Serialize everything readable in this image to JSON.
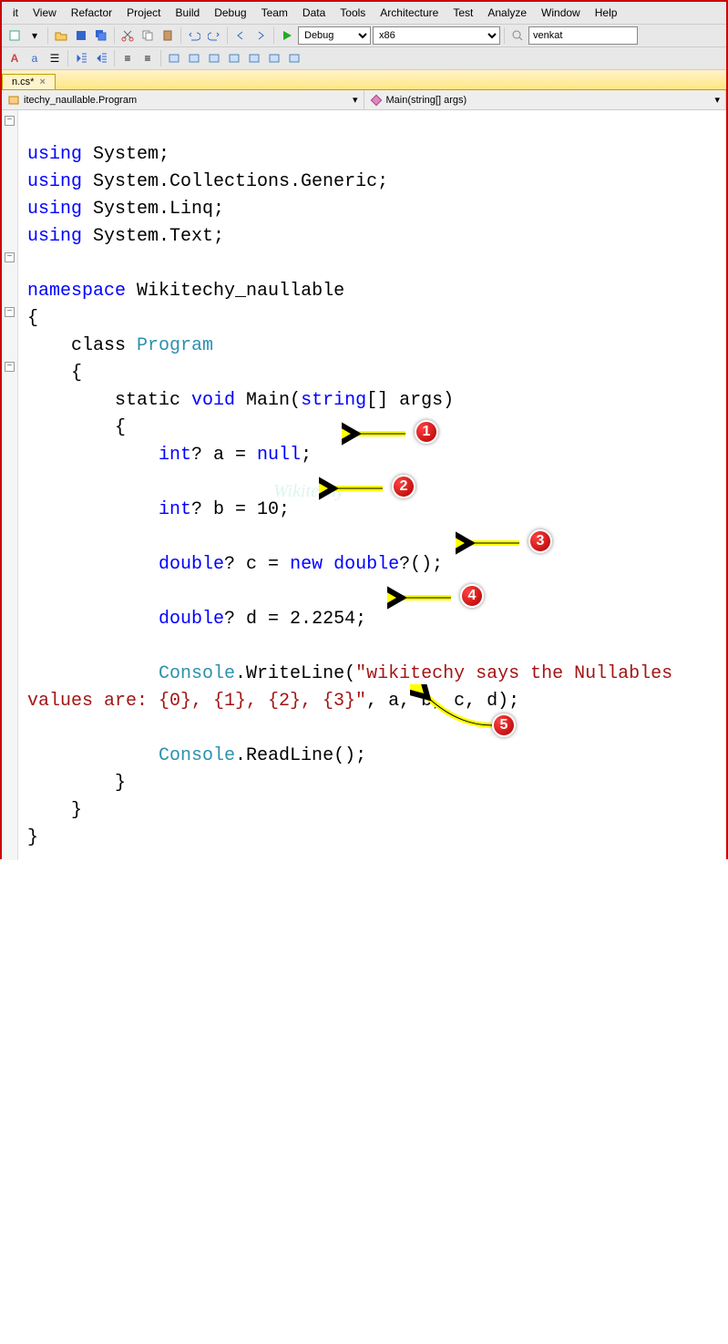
{
  "menu": [
    "it",
    "View",
    "Refactor",
    "Project",
    "Build",
    "Debug",
    "Team",
    "Data",
    "Tools",
    "Architecture",
    "Test",
    "Analyze",
    "Window",
    "Help"
  ],
  "toolbar": {
    "config": "Debug",
    "platform": "x86",
    "search": "venkat"
  },
  "tab": {
    "label": "n.cs*",
    "close": "×"
  },
  "nav": {
    "left": "itechy_naullable.Program",
    "right": "Main(string[] args)"
  },
  "code": {
    "l1a": "using",
    "l1b": " System;",
    "l2a": "using",
    "l2b": " System.Collections.Generic;",
    "l3a": "using",
    "l3b": " System.Linq;",
    "l4a": "using",
    "l4b": " System.Text;",
    "l6a": "namespace",
    "l6b": " Wikitechy_naullable",
    "l7": "{",
    "l8a": "    class ",
    "l8b": "Program",
    "l9": "    {",
    "l10a": "        static ",
    "l10b": "void",
    "l10c": " Main(",
    "l10d": "string",
    "l10e": "[] args)",
    "l11": "        {",
    "l12a": "            int",
    "l12b": "? a = ",
    "l12c": "null",
    "l12d": ";",
    "l14a": "            int",
    "l14b": "? b = 10;",
    "l16a": "            double",
    "l16b": "? c = ",
    "l16c": "new ",
    "l16d": "double",
    "l16e": "?();",
    "l18a": "            double",
    "l18b": "? d = 2.2254;",
    "l20a": "            Console",
    "l20b": ".WriteLine(",
    "l20c": "\"wikitechy says the Nullables ",
    "l21a": "values are: {0}, {1}, {2}, {3}\"",
    "l21b": ", a, b, c, d);",
    "l23a": "            Console",
    "l23b": ".ReadLine();",
    "l24": "        }",
    "l25": "    }",
    "l26": "}"
  },
  "badges": [
    "1",
    "2",
    "3",
    "4",
    "5"
  ],
  "watermark": "Wikitechy"
}
